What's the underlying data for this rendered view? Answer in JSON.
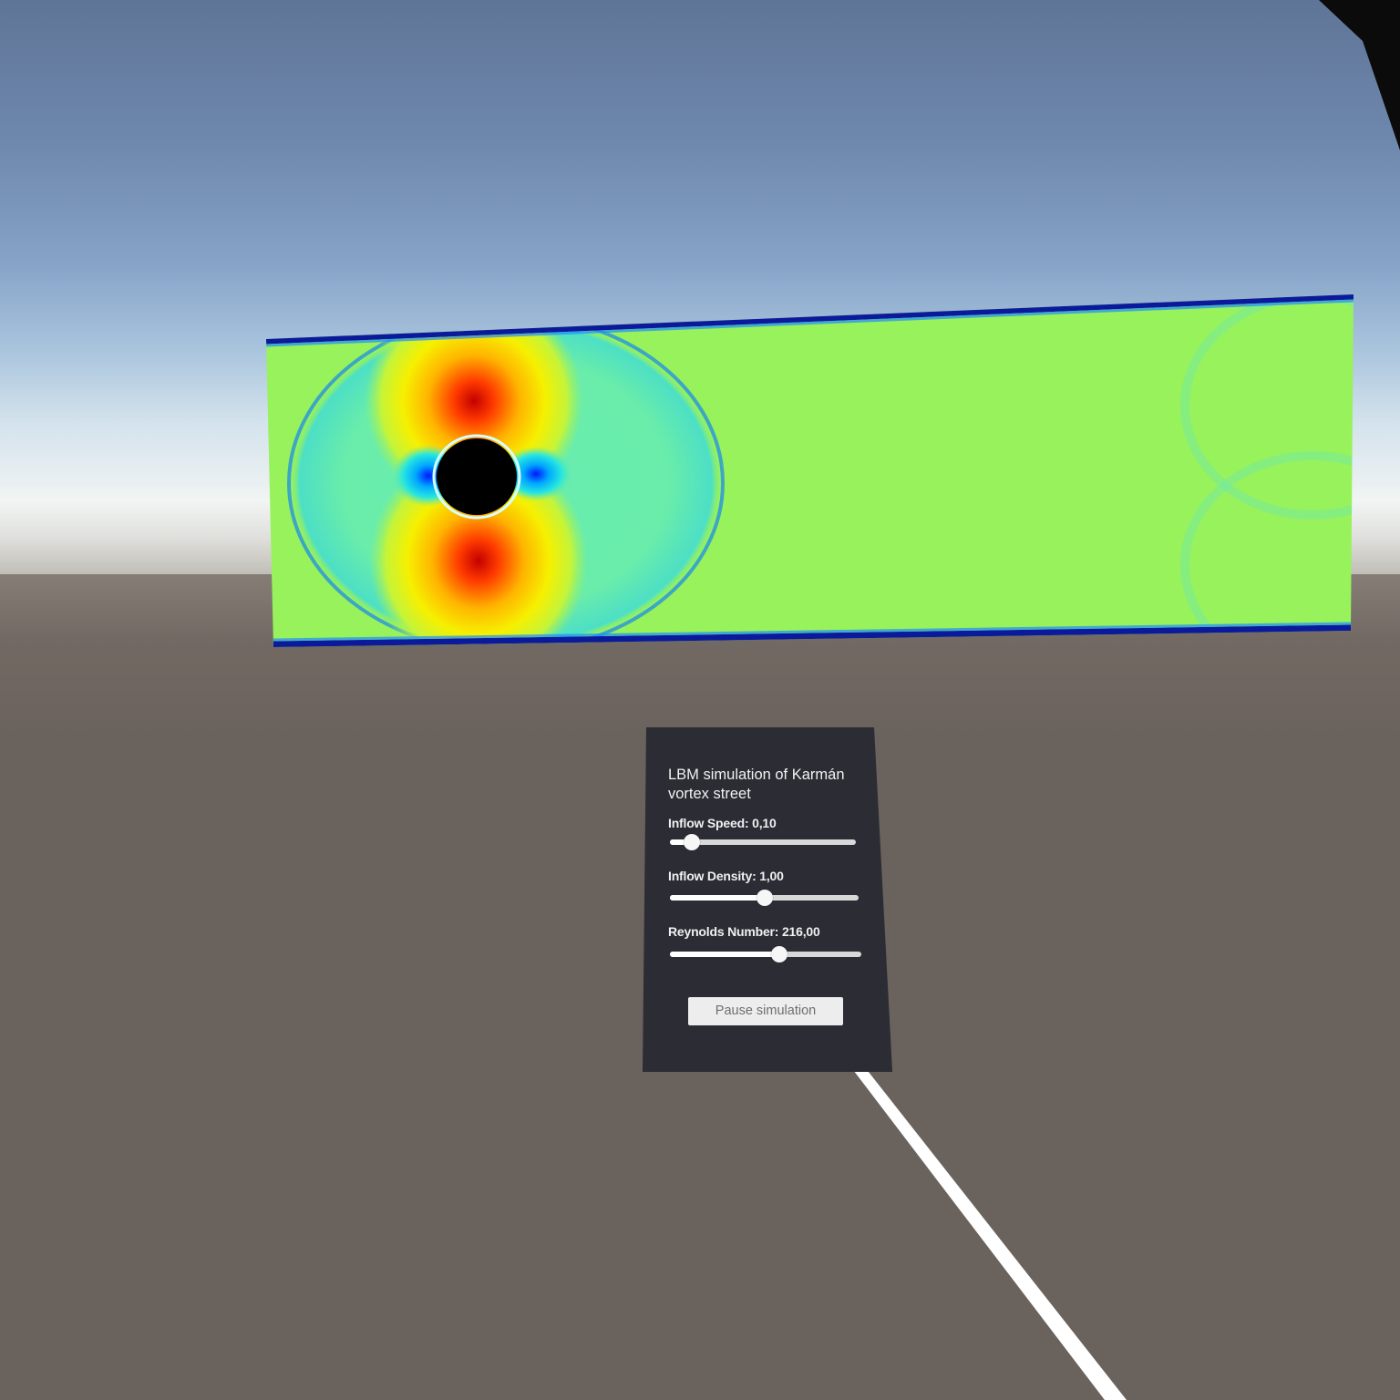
{
  "scene": {
    "sky_colors": [
      "#5f7597",
      "#86a3c8",
      "#f1f4f3"
    ],
    "ground_color": "#6a625c",
    "pointer_ray_color": "#ffffff"
  },
  "simulation_view": {
    "colormap": "jet",
    "background_field_color": "#98f25b",
    "obstacle_color": "#000000"
  },
  "panel": {
    "title": "LBM simulation of Karmán vortex street",
    "sliders": [
      {
        "label": "Inflow Speed:",
        "value_text": "0,10",
        "fraction": 0.12
      },
      {
        "label": "Inflow Density:",
        "value_text": "1,00",
        "fraction": 0.5
      },
      {
        "label": "Reynolds Number:",
        "value_text": "216,00",
        "fraction": 0.57
      }
    ],
    "pause_button_label": "Pause simulation"
  }
}
